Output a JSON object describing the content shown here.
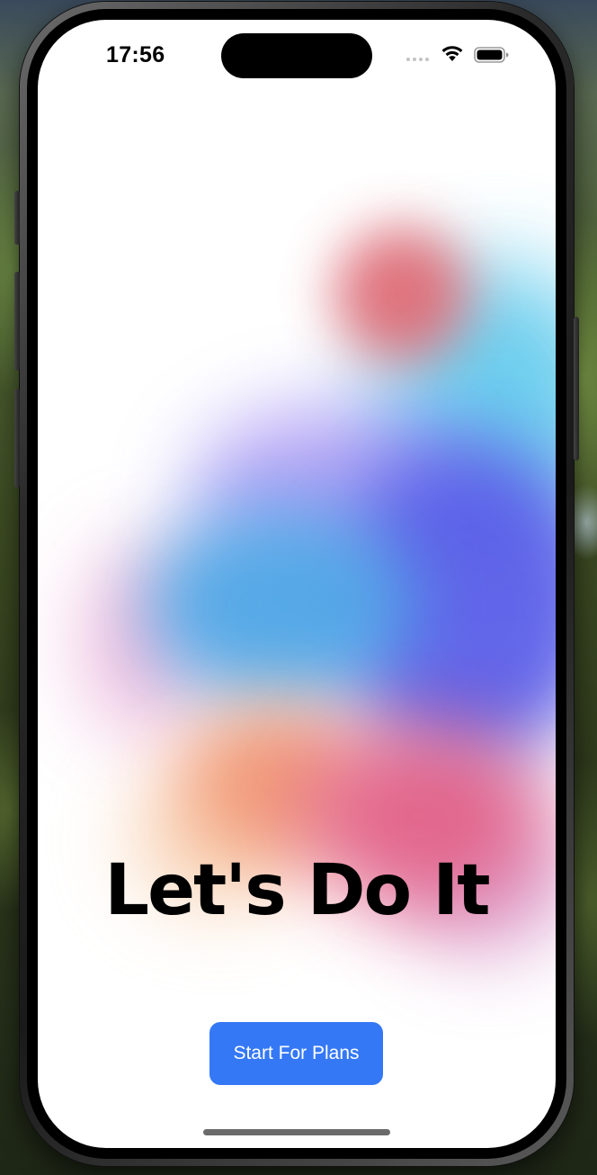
{
  "status_bar": {
    "time": "17:56",
    "icons": [
      "cellular-signal-icon",
      "wifi-icon",
      "battery-icon"
    ]
  },
  "main": {
    "headline": "Let's Do It",
    "cta_label": "Start For Plans"
  },
  "colors": {
    "cta_background": "#3478f6",
    "cta_text": "#ffffff",
    "headline": "#000000",
    "screen_background": "#ffffff"
  }
}
